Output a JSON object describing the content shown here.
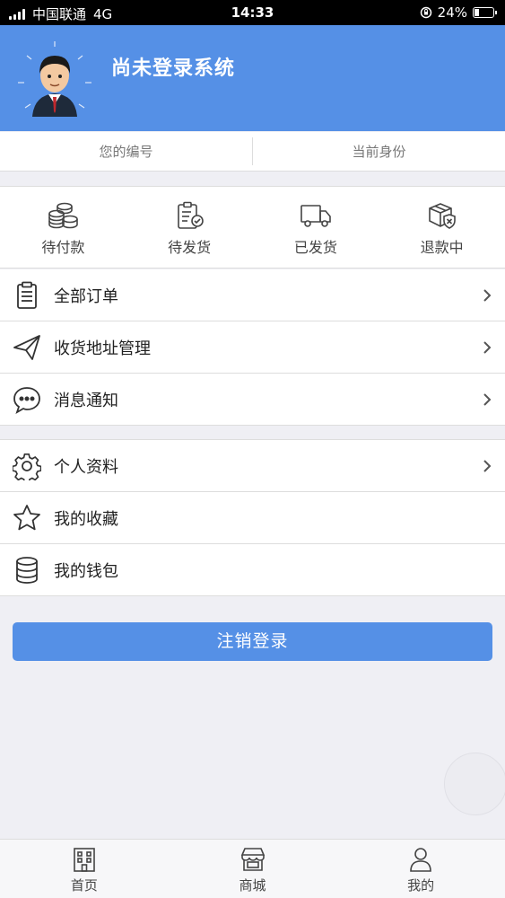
{
  "status_bar": {
    "carrier": "中国联通",
    "network": "4G",
    "time": "14:33",
    "battery": "24%",
    "battery_level": 0.24
  },
  "header": {
    "title": "尚未登录系统",
    "avatar_icon": "businessman-avatar-icon"
  },
  "info": {
    "number_label": "您的编号",
    "identity_label": "当前身份"
  },
  "orders": [
    {
      "label": "待付款",
      "icon": "coins-icon"
    },
    {
      "label": "待发货",
      "icon": "clipboard-check-icon"
    },
    {
      "label": "已发货",
      "icon": "truck-icon"
    },
    {
      "label": "退款中",
      "icon": "box-shield-icon"
    }
  ],
  "menu_group_1": [
    {
      "label": "全部订单",
      "icon": "clipboard-list-icon",
      "chevron": true
    },
    {
      "label": "收货地址管理",
      "icon": "paper-plane-icon",
      "chevron": true
    },
    {
      "label": "消息通知",
      "icon": "chat-bubble-icon",
      "chevron": true
    }
  ],
  "menu_group_2": [
    {
      "label": "个人资料",
      "icon": "gear-icon",
      "chevron": true
    },
    {
      "label": "我的收藏",
      "icon": "star-icon",
      "chevron": false
    },
    {
      "label": "我的钱包",
      "icon": "database-icon",
      "chevron": false
    }
  ],
  "logout_label": "注销登录",
  "tabs": [
    {
      "label": "首页",
      "icon": "building-icon"
    },
    {
      "label": "商城",
      "icon": "store-icon"
    },
    {
      "label": "我的",
      "icon": "user-icon"
    }
  ],
  "colors": {
    "accent": "#5590e6",
    "background": "#efeff4"
  }
}
